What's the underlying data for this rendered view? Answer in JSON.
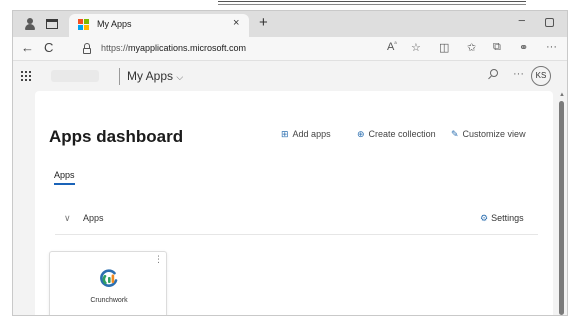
{
  "browser": {
    "tab_title": "My Apps",
    "tab_close": "×",
    "new_tab": "+",
    "window_minimize": "−",
    "url_prefix": "https://",
    "url_host": "myapplications.microsoft.com",
    "nav_back": "←",
    "nav_reload": "C",
    "toolbar_icons": [
      "read-aloud-icon",
      "favorite-star-icon",
      "split-screen-icon",
      "favorites-icon",
      "collections-icon",
      "copilot-icon",
      "more-icon"
    ]
  },
  "app_header": {
    "title": "My Apps",
    "dropdown_glyph": "⌵",
    "search_icon": "search-icon",
    "more_glyph": "···",
    "avatar_initials": "KS"
  },
  "dashboard": {
    "title": "Apps dashboard",
    "actions": [
      {
        "label": "Add apps",
        "icon": "⊞"
      },
      {
        "label": "Create collection",
        "icon": "⊕"
      },
      {
        "label": "Customize view",
        "icon": "✎"
      }
    ],
    "tabs": [
      {
        "label": "Apps",
        "active": true
      }
    ],
    "section": {
      "title": "Apps",
      "chevron": "∨",
      "settings_label": "Settings",
      "settings_icon": "⚙"
    },
    "apps": [
      {
        "name": "Crunchwork",
        "icon": "crunchwork-logo-icon",
        "more_glyph": "⋮"
      }
    ]
  },
  "colors": {
    "accent": "#1a63b8",
    "tab_bar": "#dedede",
    "logo_green": "#2e9e62",
    "logo_orange": "#f1891f",
    "logo_blue": "#2c6fb0"
  }
}
